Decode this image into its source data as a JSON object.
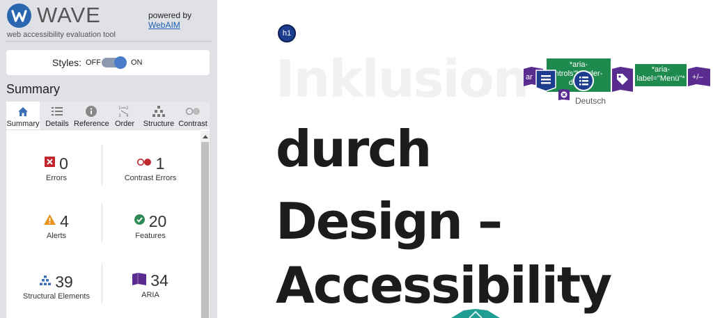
{
  "app": {
    "logo_letter": "W",
    "name": "WAVE",
    "tagline": "web accessibility evaluation tool",
    "powered_by": "powered by",
    "powered_link": "WebAIM"
  },
  "styles": {
    "label": "Styles:",
    "off": "OFF",
    "on": "ON",
    "state": "on"
  },
  "summary_title": "Summary",
  "tabs": [
    {
      "label": "Summary",
      "icon": "home-icon",
      "active": true
    },
    {
      "label": "Details",
      "icon": "list-icon",
      "active": false
    },
    {
      "label": "Reference",
      "icon": "info-icon",
      "active": false
    },
    {
      "label": "Order",
      "icon": "order-icon",
      "active": false
    },
    {
      "label": "Structure",
      "icon": "structure-icon",
      "active": false
    },
    {
      "label": "Contrast",
      "icon": "contrast-icon",
      "active": false
    }
  ],
  "stats": {
    "errors": {
      "count": "0",
      "label": "Errors",
      "icon": "error-icon",
      "color": "#c1272d"
    },
    "contrast_errors": {
      "count": "1",
      "label": "Contrast Errors",
      "icon": "contrast-error-icon",
      "color": "#c1272d"
    },
    "alerts": {
      "count": "4",
      "label": "Alerts",
      "icon": "alert-icon",
      "color": "#e8931b"
    },
    "features": {
      "count": "20",
      "label": "Features",
      "icon": "feature-icon",
      "color": "#2e8b57"
    },
    "structural": {
      "count": "39",
      "label": "Structural Elements",
      "icon": "structure-icon",
      "color": "#3b6fb6"
    },
    "aria": {
      "count": "34",
      "label": "ARIA",
      "icon": "aria-icon",
      "color": "#5b2c8f"
    }
  },
  "page": {
    "h1_badge": "h1",
    "heading_faded": "Inklusion",
    "heading_line2": "durch",
    "heading_line3": "Design –",
    "heading_line4": "Accessibility",
    "aria_label_1": "*aria-controls\"header-dropd\"*",
    "aria_label_1_line1": "*aria-",
    "aria_label_1_line2": "ntrols\"header-",
    "aria_label_1_line3": "dropd",
    "aria_label_2_line1": "*aria-",
    "aria_label_2_line2": "label=\"Menü\"*",
    "lang": "Deutsch",
    "aria_icon_stub": "ar",
    "expand_icon_text": "+/–"
  },
  "colors": {
    "sidebar_bg": "#dfe1e6",
    "accent_blue": "#2b67b1",
    "aria_purple": "#5b2c8f",
    "aria_label_green": "#1f8a4e",
    "heading_dark": "#1c1c1c"
  }
}
